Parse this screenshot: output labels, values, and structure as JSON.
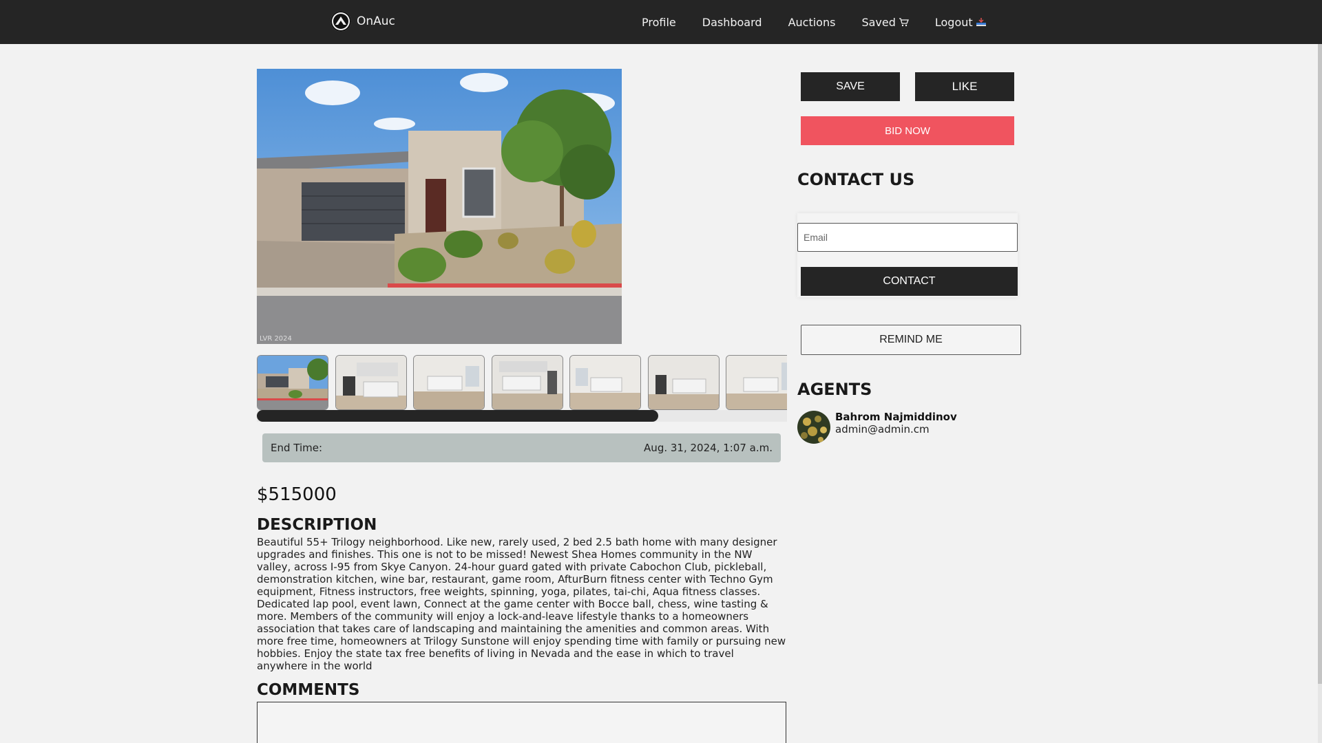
{
  "nav": {
    "brand": "OnAuc",
    "links": [
      "Profile",
      "Dashboard",
      "Auctions",
      "Saved",
      "Logout"
    ],
    "saved_icon": "cart-icon",
    "logout_icon": "logout-icon"
  },
  "listing": {
    "photo_watermark": "LVR 2024",
    "thumbnail_count": 7,
    "end_time_label": "End Time:",
    "end_time_value": "Aug. 31, 2024, 1:07 a.m.",
    "price": "$515000",
    "description_title": "DESCRIPTION",
    "description": "Beautiful 55+ Trilogy neighborhood. Like new, rarely used, 2 bed 2.5 bath home with many designer upgrades and finishes. This one is not to be missed! Newest Shea Homes community in the NW valley, across I-95 from Skye Canyon. 24-hour guard gated with private Cabochon Club, pickleball, demonstration kitchen, wine bar, restaurant, game room, AfturBurn fitness center with Techno Gym equipment, Fitness instructors, free weights, spinning, yoga, pilates, tai-chi, Aqua fitness classes. Dedicated lap pool, event lawn, Connect at the game center with Bocce ball, chess, wine tasting & more. Members of the community will enjoy a lock-and-leave lifestyle thanks to a homeowners association that takes care of landscaping and maintaining the amenities and common areas. With more free time, homeowners at Trilogy Sunstone will enjoy spending time with family or pursuing new hobbies. Enjoy the state tax free benefits of living in Nevada and the ease in which to travel anywhere in the world",
    "comments_title": "COMMENTS"
  },
  "sidebar": {
    "save_label": "SAVE",
    "like_label": "LIKE",
    "bid_label": "BID NOW",
    "contact_title": "CONTACT US",
    "email_placeholder": "Email",
    "contact_label": "CONTACT",
    "remind_label": "REMIND ME",
    "agents_title": "AGENTS",
    "agent": {
      "name": "Bahrom Najmiddinov",
      "email": "admin@admin.cm"
    }
  },
  "colors": {
    "navbar": "#252525",
    "accent_bid": "#f0545f",
    "end_time_bg": "#b8c1bf",
    "page_bg": "#f2f2f2"
  }
}
